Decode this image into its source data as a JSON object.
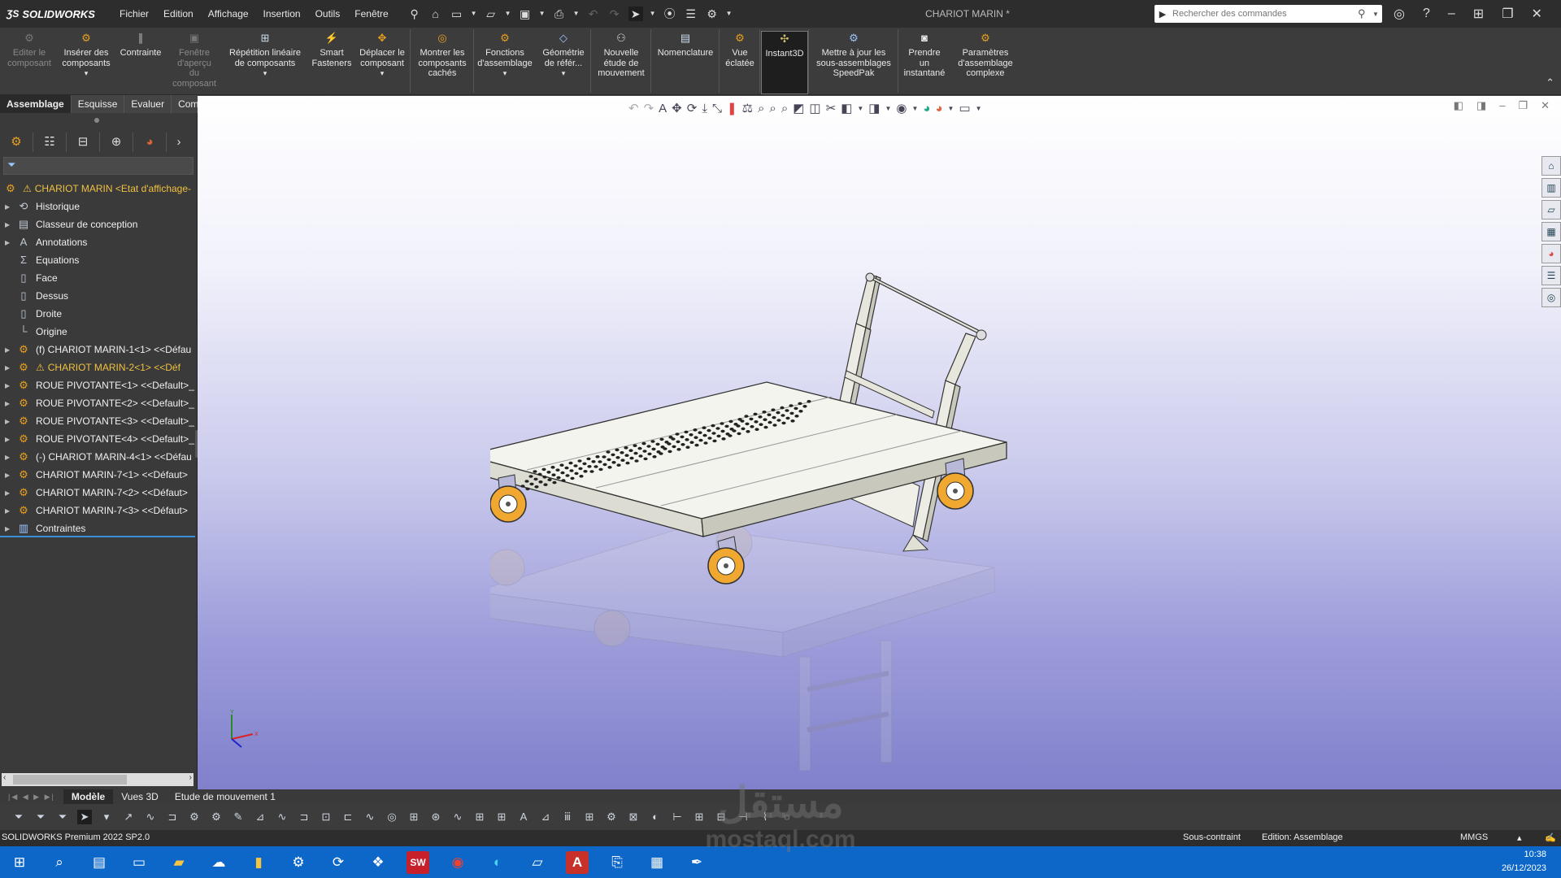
{
  "app": {
    "logo_text": "SOLIDWORKS",
    "menu": [
      "Fichier",
      "Edition",
      "Affichage",
      "Insertion",
      "Outils",
      "Fenêtre"
    ],
    "doc_title": "CHARIOT MARIN *",
    "search_placeholder": "Rechercher des commandes"
  },
  "ribbon": [
    {
      "label": "Editer le\ncomposant",
      "icon": "edit-component-icon",
      "enabled": false
    },
    {
      "label": "Insérer des\ncomposants",
      "icon": "insert-components-icon",
      "enabled": true
    },
    {
      "label": "Contrainte",
      "icon": "mate-icon",
      "enabled": true
    },
    {
      "label": "Fenêtre\nd'aperçu\ndu\ncomposant",
      "icon": "component-preview-icon",
      "enabled": false
    },
    {
      "label": "Répétition linéaire\nde composants",
      "icon": "linear-pattern-icon",
      "enabled": true
    },
    {
      "label": "Smart\nFasteners",
      "icon": "smart-fasteners-icon",
      "enabled": true
    },
    {
      "label": "Déplacer le\ncomposant",
      "icon": "move-component-icon",
      "enabled": true
    },
    {
      "label": "Montrer les\ncomposants\ncachés",
      "icon": "show-hidden-icon",
      "enabled": true
    },
    {
      "label": "Fonctions\nd'assemblage",
      "icon": "assembly-features-icon",
      "enabled": true
    },
    {
      "label": "Géométrie\nde référ...",
      "icon": "reference-geometry-icon",
      "enabled": true
    },
    {
      "label": "Nouvelle\nétude de\nmouvement",
      "icon": "motion-study-icon",
      "enabled": true
    },
    {
      "label": "Nomenclature",
      "icon": "bom-icon",
      "enabled": true
    },
    {
      "label": "Vue\néclatée",
      "icon": "exploded-view-icon",
      "enabled": true
    },
    {
      "label": "Instant3D",
      "icon": "instant3d-icon",
      "enabled": true
    },
    {
      "label": "Mettre à jour les\nsous-assemblages\nSpeedPak",
      "icon": "speedpak-icon",
      "enabled": true
    },
    {
      "label": "Prendre\nun\ninstantané",
      "icon": "snapshot-icon",
      "enabled": true
    },
    {
      "label": "Paramètres\nd'assemblage\ncomplexe",
      "icon": "large-assembly-icon",
      "enabled": true
    }
  ],
  "cmd_tabs": [
    "Assemblage",
    "Esquisse",
    "Evaluer",
    "Compléments de SOLIDWORKS"
  ],
  "tree": {
    "root": "CHARIOT MARIN <Etat d'affichage-",
    "items": [
      {
        "label": "Historique",
        "icon": "history-icon",
        "expand": true
      },
      {
        "label": "Classeur de conception",
        "icon": "design-binder-icon",
        "expand": true
      },
      {
        "label": "Annotations",
        "icon": "annotations-icon",
        "expand": true
      },
      {
        "label": "Equations",
        "icon": "equations-icon",
        "expand": false
      },
      {
        "label": "Face",
        "icon": "plane-icon",
        "expand": false
      },
      {
        "label": "Dessus",
        "icon": "plane-icon",
        "expand": false
      },
      {
        "label": "Droite",
        "icon": "plane-icon",
        "expand": false
      },
      {
        "label": "Origine",
        "icon": "origin-icon",
        "expand": false
      },
      {
        "label": "(f) CHARIOT MARIN-1<1>  <<Défau",
        "icon": "subassembly-icon",
        "expand": true
      },
      {
        "label": "CHARIOT MARIN-2<1>  <<Déf",
        "icon": "subassembly-icon",
        "expand": true,
        "warn": true
      },
      {
        "label": "ROUE PIVOTANTE<1>  <<Default>_",
        "icon": "subassembly-icon",
        "expand": true
      },
      {
        "label": "ROUE PIVOTANTE<2>  <<Default>_",
        "icon": "subassembly-icon",
        "expand": true
      },
      {
        "label": "ROUE PIVOTANTE<3>  <<Default>_",
        "icon": "subassembly-icon",
        "expand": true
      },
      {
        "label": "ROUE PIVOTANTE<4>  <<Default>_",
        "icon": "subassembly-icon",
        "expand": true
      },
      {
        "label": "(-) CHARIOT MARIN-4<1>  <<Défau",
        "icon": "subassembly-icon",
        "expand": true
      },
      {
        "label": "CHARIOT MARIN-7<1>  <<Défaut>",
        "icon": "subassembly-icon",
        "expand": true
      },
      {
        "label": "CHARIOT MARIN-7<2>  <<Défaut>",
        "icon": "subassembly-icon",
        "expand": true
      },
      {
        "label": "CHARIOT MARIN-7<3>  <<Défaut>",
        "icon": "subassembly-icon",
        "expand": true
      },
      {
        "label": "Contraintes",
        "icon": "mates-folder-icon",
        "expand": true
      }
    ]
  },
  "bottom_tabs": [
    "Modèle",
    "Vues 3D",
    "Etude de mouvement 1"
  ],
  "status": {
    "product": "SOLIDWORKS Premium 2022 SP2.0",
    "state": "Sous-contraint",
    "edit": "Edition: Assemblage",
    "units": "MMGS"
  },
  "clock": {
    "time": "10:38",
    "date": "26/12/2023"
  },
  "watermark": {
    "arabic": "مستقل",
    "latin": "mostaql.com"
  },
  "colors": {
    "accent": "#0d67c9",
    "component": "#e8a020",
    "warning": "#f0c040",
    "wheel": "#f0a830"
  }
}
